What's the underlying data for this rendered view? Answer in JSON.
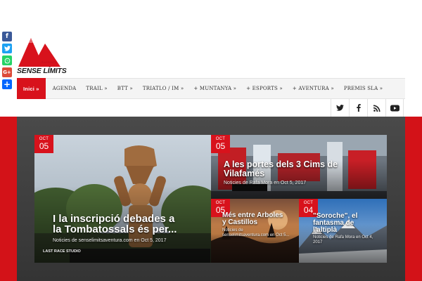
{
  "share": {
    "items": [
      {
        "label": "f",
        "color": "#3b5998"
      },
      {
        "label": "t",
        "color": "#1da1f2"
      },
      {
        "label": "w",
        "color": "#25d366"
      },
      {
        "label": "G+",
        "color": "#dd4b39"
      },
      {
        "label": "+",
        "color": "#0166ff"
      }
    ]
  },
  "logo": {
    "name": "SENSE LÍMITS",
    "script": "Aventura",
    "color": "#d8121c"
  },
  "nav": {
    "items": [
      {
        "label": "Inici »",
        "active": true
      },
      {
        "label": "AGENDA"
      },
      {
        "label": "TRAIL »"
      },
      {
        "label": "BTT »"
      },
      {
        "label": "TRIATLO / IM »"
      },
      {
        "label": "+ MUNTANYA »"
      },
      {
        "label": "+ ESPORTS »"
      },
      {
        "label": "+ AVENTURA »"
      },
      {
        "label": "PREMIS SLA »"
      }
    ]
  },
  "social": [
    "twitter-icon",
    "facebook-icon",
    "rss-icon",
    "youtube-icon"
  ],
  "accent": "#d8121c",
  "posts": [
    {
      "month": "OCT",
      "day": "05",
      "title_line1": "I la inscripció debades a",
      "title_line2": "la Tombatossals és per...",
      "meta": "Noticies de senselimitsaventura.com en Oct 5, 2017",
      "photo_caption": "LAST RACE STUDIO"
    },
    {
      "month": "OCT",
      "day": "05",
      "title_line1": "A les portes dels 3 Cims de",
      "title_line2": "Vilafamés",
      "meta": "Noticies de Rafa Mora en Oct 5, 2017"
    },
    {
      "month": "OCT",
      "day": "05",
      "title_line1": "Més entre Arboles",
      "title_line2": "y Castillos",
      "meta_line1": "Noticies de",
      "meta_line2": "senselimitsaventura.com en Oct 5..."
    },
    {
      "month": "OCT",
      "day": "04",
      "title_line1": "\"Soroche\", el",
      "title_line2": "fantasma de",
      "title_line3": "l'altiplà",
      "meta_line1": "Noticies de Rafa Mora en Oct 4,",
      "meta_line2": "2017"
    }
  ]
}
